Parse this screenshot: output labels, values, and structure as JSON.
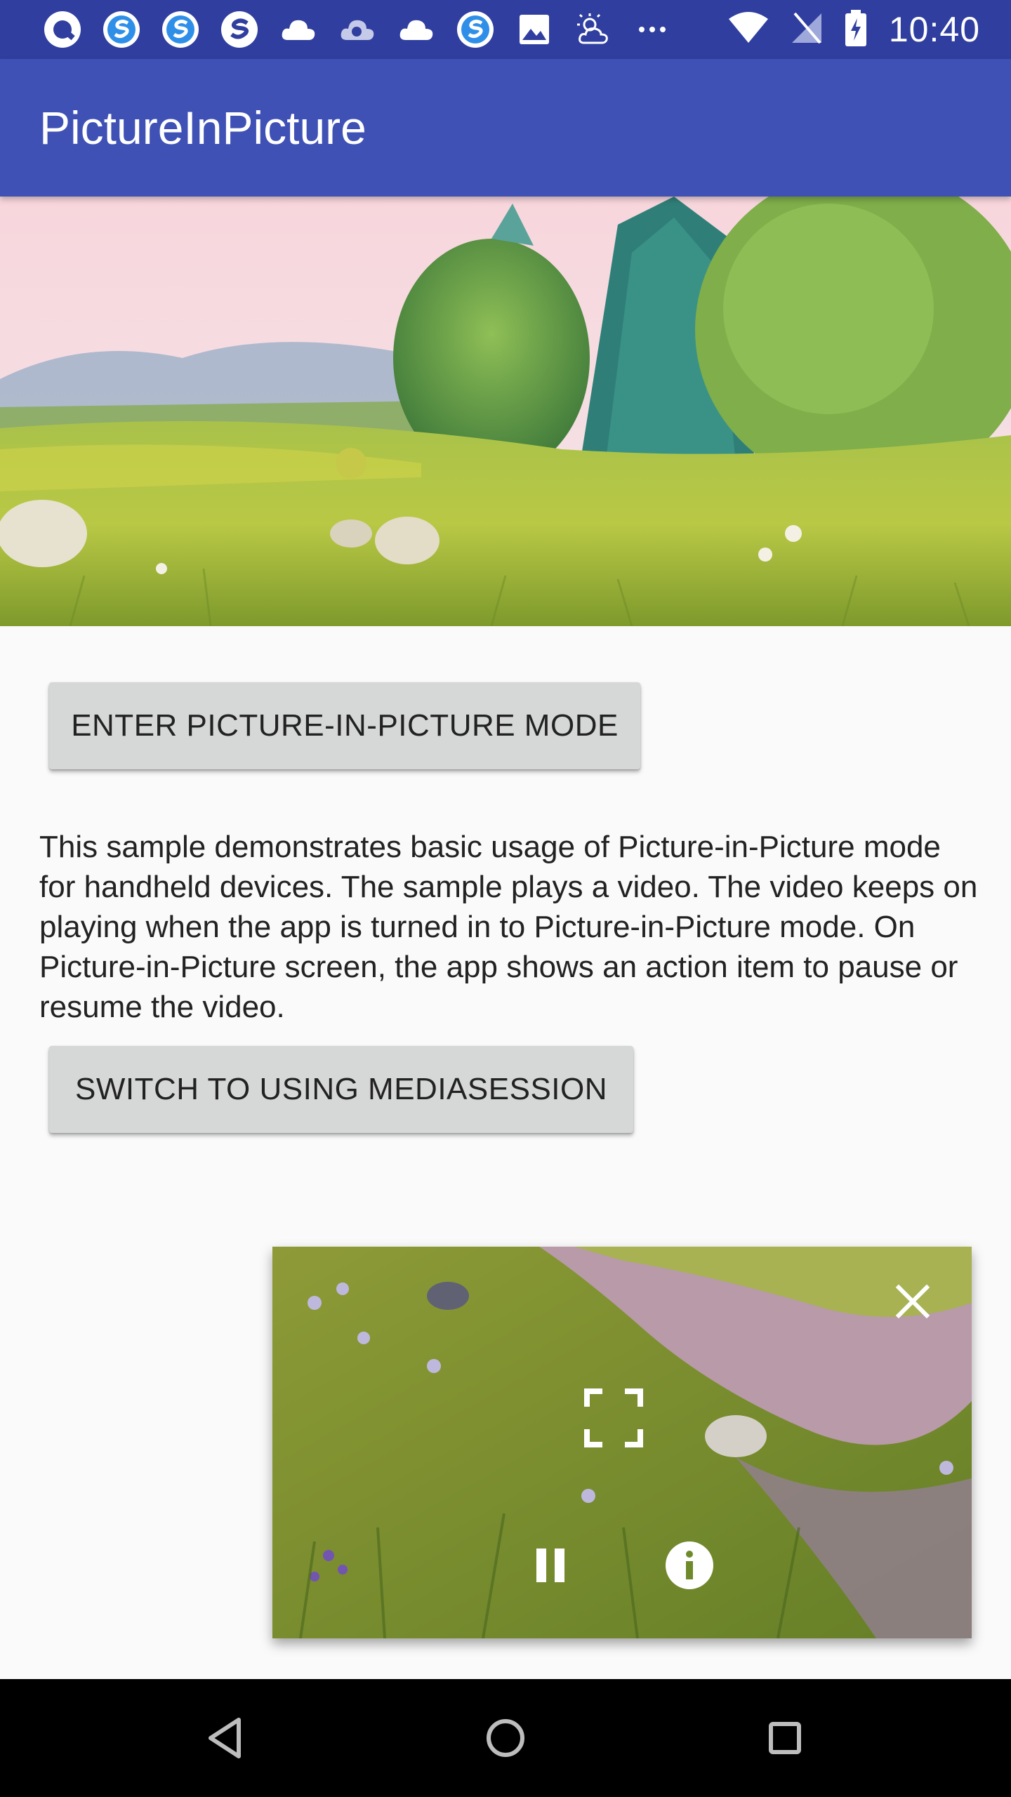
{
  "status_bar": {
    "time": "10:40",
    "left_icons": [
      "app-q-icon",
      "app-s-icon",
      "app-s-icon",
      "app-s-icon",
      "cloud-icon",
      "cloud-icon",
      "cloud-icon",
      "app-s-icon",
      "image-icon",
      "weather-icon",
      "more-icon"
    ],
    "right_icons": [
      "wifi-icon",
      "signal-icon",
      "battery-icon"
    ]
  },
  "app_bar": {
    "title": "PictureInPicture"
  },
  "main": {
    "enter_pip_label": "ENTER PICTURE-IN-PICTURE MODE",
    "description": "This sample demonstrates basic usage of Picture-in-Picture mode for handheld devices. The sample plays a video. The video keeps on playing when the app is turned in to Picture-in-Picture mode. On Picture-in-Picture screen, the app shows an action item to pause or resume the video.",
    "switch_label": "SWITCH TO USING MEDIASESSION"
  },
  "pip_window": {
    "controls": [
      "close-icon",
      "fullscreen-icon",
      "pause-icon",
      "info-icon"
    ]
  },
  "nav_bar": {
    "buttons": [
      "back-icon",
      "home-icon",
      "recents-icon"
    ]
  },
  "colors": {
    "status_bar": "#303f9f",
    "app_bar": "#3f51b5",
    "background": "#fafafa",
    "button": "#d6d7d7",
    "nav_bar": "#000000"
  }
}
